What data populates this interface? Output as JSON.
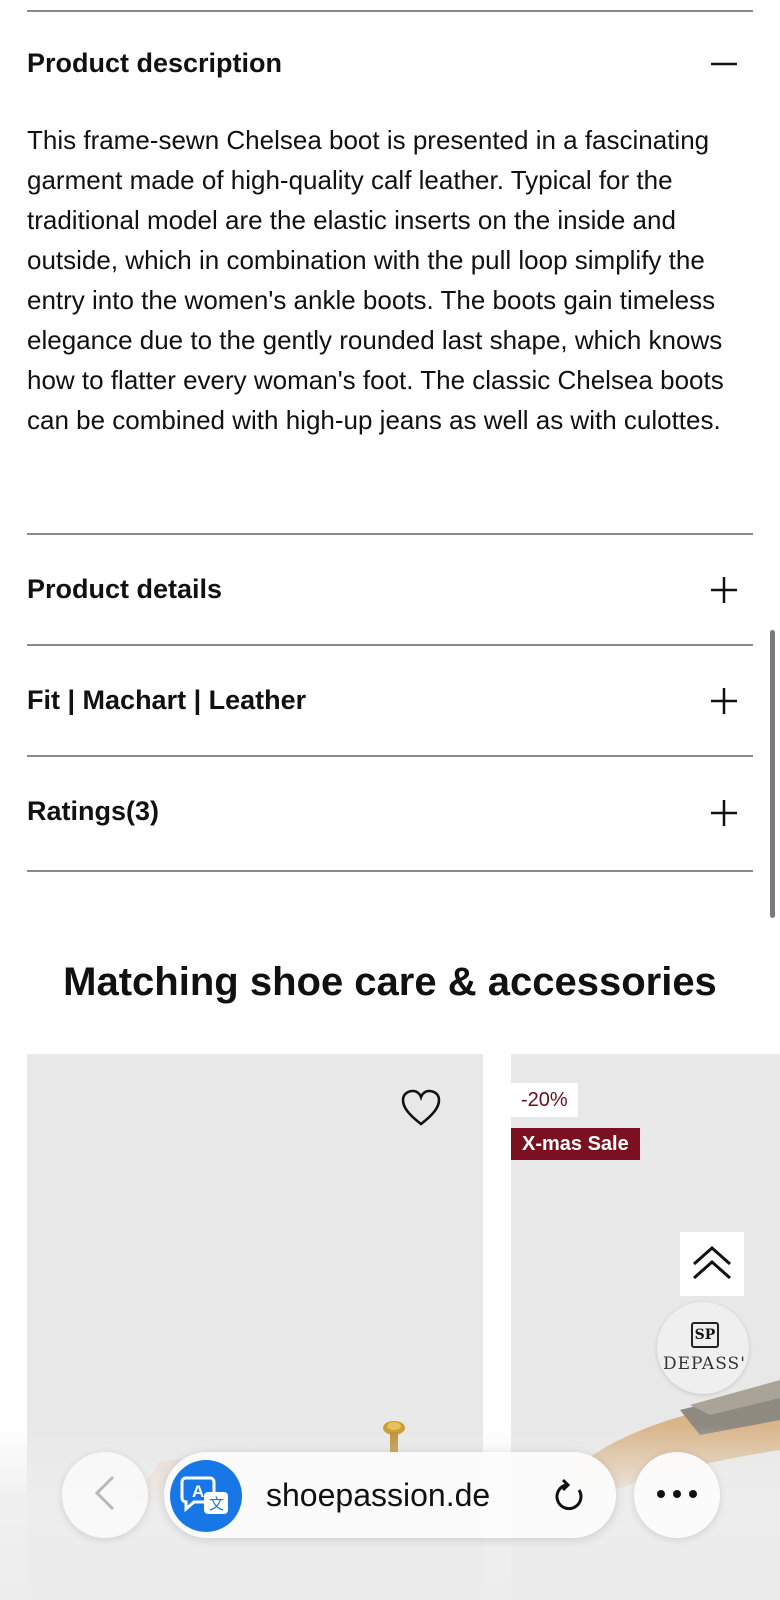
{
  "accordion": {
    "description": {
      "title": "Product description",
      "toggle_icon": "minus-icon",
      "text": "This frame-sewn Chelsea boot is presented in a fascinating garment made of high-quality calf leather. Typical for the traditional model are the elastic inserts on the inside and outside, which in combination with the pull loop simplify the entry into the women's ankle boots. The boots gain timeless elegance due to the gently rounded last shape, which knows how to flatter every woman's foot. The classic Chelsea boots can be combined with high-up jeans as well as with culottes."
    },
    "items": [
      {
        "title": "Product details",
        "toggle_icon": "plus-icon"
      },
      {
        "title": "Fit | Machart | Leather",
        "toggle_icon": "plus-icon"
      },
      {
        "title": "Ratings(3)",
        "toggle_icon": "plus-icon"
      }
    ]
  },
  "section": {
    "title": "Matching shoe care & accessories"
  },
  "products": [
    {
      "wishlist_icon": "heart-icon"
    },
    {
      "discount_badge": "-20%",
      "sale_badge": "X-mas Sale",
      "brand_watermark": "DEPASS'"
    }
  ],
  "floating": {
    "scroll_top_icon": "double-chevron-up-icon"
  },
  "browser": {
    "back_icon": "chevron-left-icon",
    "translate_icon": "translate-icon",
    "url": "shoepassion.de",
    "reload_icon": "reload-icon",
    "more_icon": "more-dots-icon"
  },
  "colors": {
    "sale_badge_bg": "#7a1020",
    "discount_text": "#6b0f1a",
    "translate_blue": "#1877e6",
    "card_bg": "#e8e8e8"
  }
}
